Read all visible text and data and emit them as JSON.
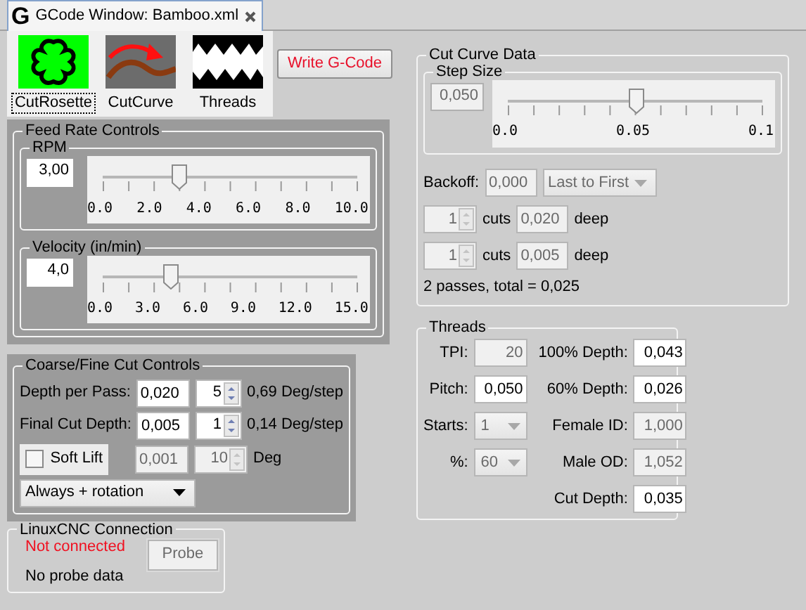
{
  "tab": {
    "title": "GCode Window: Bamboo.xml",
    "logo": "G"
  },
  "modes": [
    {
      "kind": "rosette",
      "label": "CutRosette",
      "selected": true
    },
    {
      "kind": "curve",
      "label": "CutCurve",
      "selected": false
    },
    {
      "kind": "threads",
      "label": "Threads",
      "selected": false
    }
  ],
  "write_button": "Write G-Code",
  "feed_rate": {
    "title": "Feed Rate Controls",
    "sliders": [
      {
        "title": "RPM",
        "value": "3,00",
        "level": 0.3,
        "ticks": [
          "0.0",
          "2.0",
          "4.0",
          "6.0",
          "8.0",
          "10.0"
        ]
      },
      {
        "title": "Velocity (in/min)",
        "value": "4,0",
        "level": 0.267,
        "ticks": [
          "0.0",
          "3.0",
          "6.0",
          "9.0",
          "12.0",
          "15.0"
        ]
      }
    ]
  },
  "coarse_fine": {
    "title": "Coarse/Fine Cut Controls",
    "rows": [
      {
        "label": "Depth per Pass:",
        "depth": "0,020",
        "count": "5",
        "reading": "0,69 Deg/step"
      },
      {
        "label": "Final Cut Depth:",
        "depth": "0,005",
        "count": "1",
        "reading": "0,14 Deg/step"
      }
    ],
    "soft_lift": {
      "label": "Soft Lift",
      "checked": false,
      "depth": "0,001",
      "count": "10",
      "unit": "Deg",
      "disabled": true
    },
    "mode": "Always + rotation"
  },
  "linuxcnc": {
    "title": "LinuxCNC Connection",
    "status": "Not connected",
    "connected": false,
    "probe_button": "Probe",
    "probe_disabled": true,
    "probe_data": "No probe data"
  },
  "cut_curve": {
    "title": "Cut Curve Data",
    "step_size": {
      "title": "Step Size",
      "value": "0,050",
      "disabled": true,
      "level": 0.5,
      "ticks": [
        "0.0",
        "0.05",
        "0.1"
      ]
    },
    "backoff": {
      "label": "Backoff:",
      "value": "0,000",
      "order": "Last to First",
      "disabled": true
    },
    "passes": [
      {
        "count": "1",
        "unit": "cuts",
        "depth": "0,020",
        "suffix": "deep",
        "disabled": true
      },
      {
        "count": "1",
        "unit": "cuts",
        "depth": "0,005",
        "suffix": "deep",
        "disabled": true
      }
    ],
    "summary": "2 passes, total = 0,025"
  },
  "threads": {
    "title": "Threads",
    "left_fields": [
      {
        "label": "TPI:",
        "value": "20",
        "kind": "field",
        "disabled": true
      },
      {
        "label": "Pitch:",
        "value": "0,050",
        "kind": "field",
        "disabled": false
      },
      {
        "label": "Starts:",
        "value": "1",
        "kind": "select",
        "disabled": true
      },
      {
        "label": "%:",
        "value": "60",
        "kind": "select",
        "disabled": true
      }
    ],
    "right_fields": [
      {
        "label": "100% Depth:",
        "value": "0,043",
        "kind": "field",
        "disabled": false
      },
      {
        "label": "60% Depth:",
        "value": "0,026",
        "kind": "field",
        "disabled": false
      },
      {
        "label": "Female ID:",
        "value": "1,000",
        "kind": "field",
        "disabled": true
      },
      {
        "label": "Male OD:",
        "value": "1,052",
        "kind": "field",
        "disabled": true
      },
      {
        "label": "Cut Depth:",
        "value": "0,035",
        "kind": "field",
        "disabled": false
      }
    ]
  }
}
